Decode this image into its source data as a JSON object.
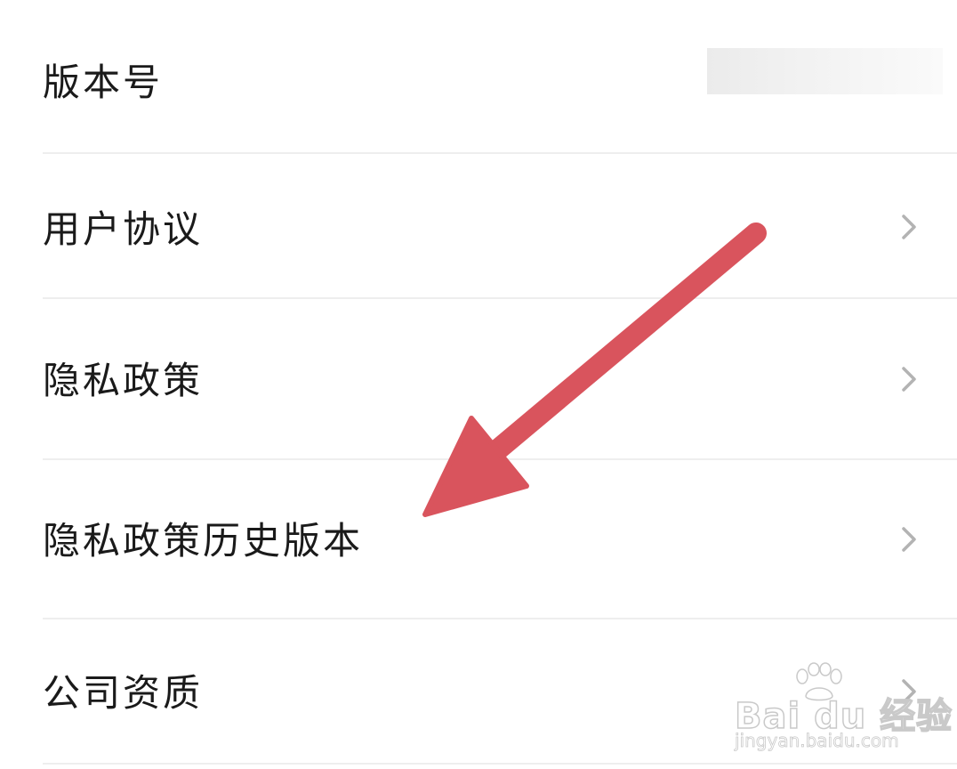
{
  "settings": {
    "items": [
      {
        "label": "版本号",
        "has_chevron": false
      },
      {
        "label": "用户协议",
        "has_chevron": true
      },
      {
        "label": "隐私政策",
        "has_chevron": true
      },
      {
        "label": "隐私政策历史版本",
        "has_chevron": true
      },
      {
        "label": "公司资质",
        "has_chevron": true
      }
    ]
  },
  "annotation": {
    "arrow_color": "#d9545d"
  },
  "watermark": {
    "brand": "Bai du 经验",
    "site": "jingyan.baidu.com"
  },
  "colors": {
    "text": "#1a1a1a",
    "divider": "#eeeeee",
    "chevron": "#b3b3b3"
  }
}
